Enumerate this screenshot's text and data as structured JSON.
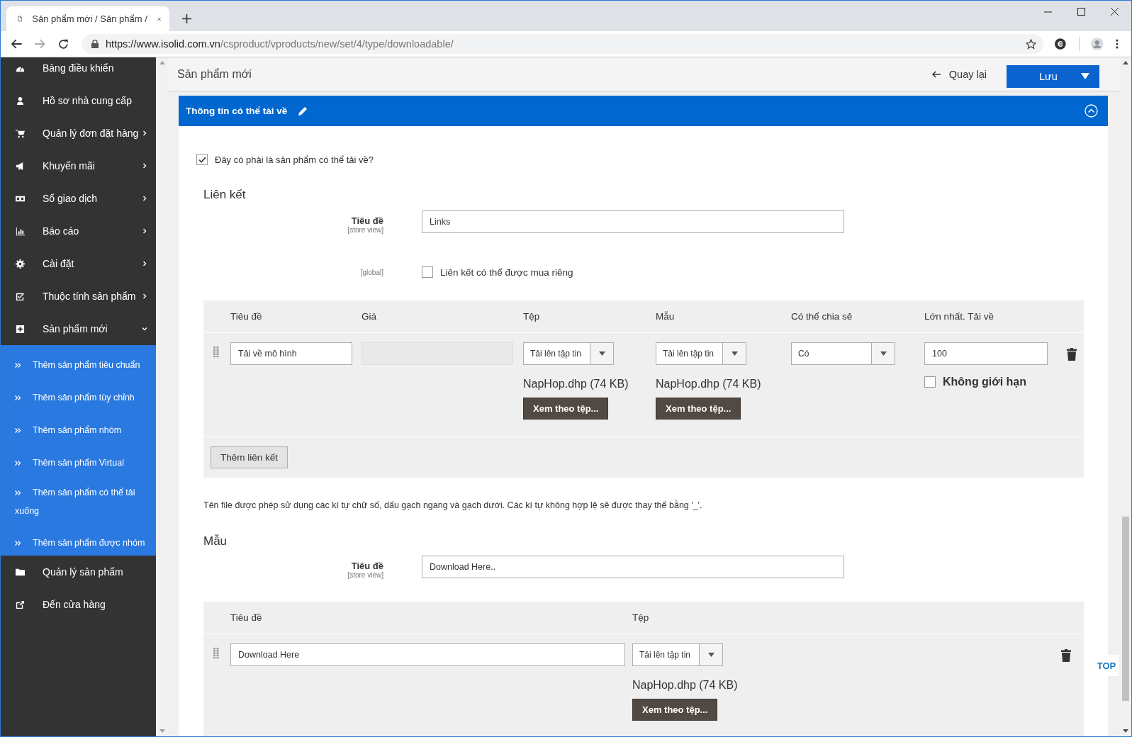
{
  "browser": {
    "tab_title": "Sản phẩm mới / Sản phẩm /",
    "url_host": "https://www.isolid.com.vn",
    "url_path": "/csproduct/vproducts/new/set/4/type/downloadable/"
  },
  "sidebar": {
    "items": [
      {
        "label": "Bảng điều khiển",
        "expandable": false
      },
      {
        "label": "Hồ sơ nhà cung cấp",
        "expandable": false
      },
      {
        "label": "Quản lý đơn đặt hàng",
        "expandable": true,
        "expanded": false
      },
      {
        "label": "Khuyến mãi",
        "expandable": true,
        "expanded": false
      },
      {
        "label": "Sổ giao dịch",
        "expandable": true,
        "expanded": false
      },
      {
        "label": "Báo cáo",
        "expandable": true,
        "expanded": false
      },
      {
        "label": "Cài đặt",
        "expandable": true,
        "expanded": false
      },
      {
        "label": "Thuộc tính sản phẩm",
        "expandable": true,
        "expanded": false
      },
      {
        "label": "Sản phẩm mới",
        "expandable": true,
        "expanded": true,
        "children": [
          {
            "label": "Thêm sản phẩm tiêu chuẩn"
          },
          {
            "label": "Thêm sản phẩm tùy chỉnh"
          },
          {
            "label": "Thêm sản phẩm nhóm"
          },
          {
            "label": "Thêm sản phẩm Virtual"
          },
          {
            "label": "Thêm sản phẩm có thể tải xuống"
          },
          {
            "label": "Thêm sản phẩm được nhóm"
          }
        ]
      },
      {
        "label": "Quản lý sản phẩm",
        "expandable": false
      },
      {
        "label": "Đến cửa hàng",
        "expandable": false
      }
    ]
  },
  "header": {
    "title": "Sản phẩm mới",
    "back": "Quay lại",
    "save": "Lưu"
  },
  "section": {
    "title": "Thông tin có thể tải về",
    "expanded": true,
    "downloadable": {
      "label": "Đây có phải là sản phẩm có thể tải về?",
      "checked": true
    },
    "links": {
      "heading": "Liên kết",
      "title_field": {
        "label": "Tiêu đề",
        "scope": "[store view]",
        "value": "Links"
      },
      "separate": {
        "scope": "[global]",
        "label": "Liên kết có thể được mua riêng",
        "checked": false
      },
      "columns": [
        "Tiêu đề",
        "Giá",
        "Tệp",
        "Mẫu",
        "Có thể chia sẻ",
        "Lớn nhất. Tải về"
      ],
      "rows": [
        {
          "title": "Tải về mô hình",
          "price_disabled": true,
          "file": {
            "select": "Tải lên tập tin",
            "file_name": "NapHop.dhp (74 KB)",
            "view_button": "Xem theo tệp..."
          },
          "sample": {
            "select": "Tải lên tập tin",
            "file_name": "NapHop.dhp (74 KB)",
            "view_button": "Xem theo tệp..."
          },
          "shareable": "Có",
          "max_downloads": "100",
          "unlimited": {
            "label": "Không giới hạn",
            "checked": false
          }
        }
      ],
      "add_button": "Thêm liên kết"
    },
    "note": "Tên file được phép sử dụng các kí tự chữ số, dấu gạch ngang và gạch dưới. Các kí tự không hợp lệ sẽ được thay thế bằng '_'.",
    "samples": {
      "heading": "Mẫu",
      "title_field": {
        "label": "Tiêu đề",
        "scope": "[store view]",
        "value": "Download Here.."
      },
      "columns": [
        "Tiêu đề",
        "Tệp"
      ],
      "rows": [
        {
          "title": "Download Here",
          "file": {
            "select": "Tải lên tập tin",
            "file_name": "NapHop.dhp (74 KB)",
            "view_button": "Xem theo tệp..."
          }
        }
      ]
    }
  },
  "top_button": "TOP"
}
